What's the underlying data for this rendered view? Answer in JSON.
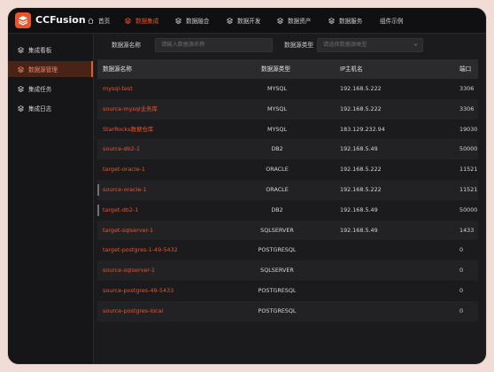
{
  "app": {
    "name": "CCFusion",
    "accent": "#e8552c"
  },
  "nav": [
    {
      "label": "首页",
      "icon": "home-icon",
      "active": false
    },
    {
      "label": "数据集成",
      "icon": "layers-icon",
      "active": true
    },
    {
      "label": "数据融合",
      "icon": "layers-icon",
      "active": false
    },
    {
      "label": "数据开发",
      "icon": "layers-icon",
      "active": false
    },
    {
      "label": "数据资产",
      "icon": "layers-icon",
      "active": false
    },
    {
      "label": "数据服务",
      "icon": "layers-icon",
      "active": false
    },
    {
      "label": "组件示例",
      "icon": "",
      "active": false
    }
  ],
  "sidebar": [
    {
      "label": "集成看板",
      "icon": "layers-icon",
      "active": false
    },
    {
      "label": "数据源管理",
      "icon": "layers-icon",
      "active": true
    },
    {
      "label": "集成任务",
      "icon": "layers-icon",
      "active": false
    },
    {
      "label": "集成日志",
      "icon": "layers-icon",
      "active": false
    }
  ],
  "filter": {
    "name_label": "数据源名称",
    "name_placeholder": "请输入数据源名称",
    "type_label": "数据源类型",
    "type_placeholder": "请选择数据源类型"
  },
  "table": {
    "headers": [
      "数据源名称",
      "数据源类型",
      "IP主机名",
      "端口"
    ],
    "rows": [
      {
        "name": "mysql-test",
        "type": "MYSQL",
        "ip": "192.168.5.222",
        "port": "3306"
      },
      {
        "name": "source-mysql业务库",
        "type": "MYSQL",
        "ip": "192.168.5.222",
        "port": "3306"
      },
      {
        "name": "StarRocks数据仓库",
        "type": "MYSQL",
        "ip": "183.129.232.94",
        "port": "19030"
      },
      {
        "name": "source-db2-1",
        "type": "DB2",
        "ip": "192.168.5.49",
        "port": "50000"
      },
      {
        "name": "target-oracle-1",
        "type": "ORACLE",
        "ip": "192.168.5.222",
        "port": "11521"
      },
      {
        "name": "source-oracle-1",
        "type": "ORACLE",
        "ip": "192.168.5.222",
        "port": "11521"
      },
      {
        "name": "target-db2-1",
        "type": "DB2",
        "ip": "192.168.5.49",
        "port": "50000"
      },
      {
        "name": "target-sqlserver-1",
        "type": "SQLSERVER",
        "ip": "192.168.5.49",
        "port": "1433"
      },
      {
        "name": "target-postgres-1-49-5432",
        "type": "POSTGRESQL",
        "ip": "",
        "port": "0"
      },
      {
        "name": "source-sqlserver-1",
        "type": "SQLSERVER",
        "ip": "",
        "port": "0"
      },
      {
        "name": "source-postgres-49-5433",
        "type": "POSTGRESQL",
        "ip": "",
        "port": "0"
      },
      {
        "name": "source-postgres-local",
        "type": "POSTGRESQL",
        "ip": "",
        "port": "0"
      }
    ]
  }
}
